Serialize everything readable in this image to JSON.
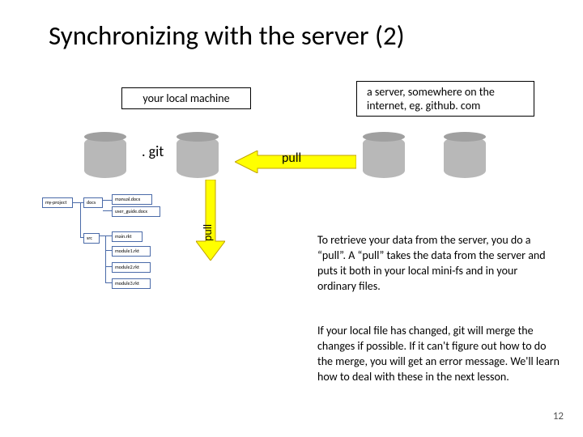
{
  "title": "Synchronizing with the server (2)",
  "labels": {
    "local": "your local machine",
    "server": "a server, somewhere on the internet, eg. github. com",
    "git": ". git",
    "pull_h": "pull",
    "pull_v": "pull"
  },
  "fs": {
    "root": "my-project",
    "docs": "docs",
    "manual": "manual.docx",
    "userguide": "user_guide.docx",
    "src": "src",
    "main": "main.rkt",
    "mod1": "module1.rkt",
    "mod2": "module2.rkt",
    "mod3": "module3.rkt"
  },
  "para1": "To retrieve your data from the server, you do a “pull”.  A “pull” takes the data from the server and puts it both in your local mini-fs and in your ordinary files.",
  "para2": "If your local file has changed, git will merge the changes if possible.  If it can't figure out how to do the merge, you will get an error message.  We'll learn how to deal with these in the next lesson.",
  "page": "12"
}
